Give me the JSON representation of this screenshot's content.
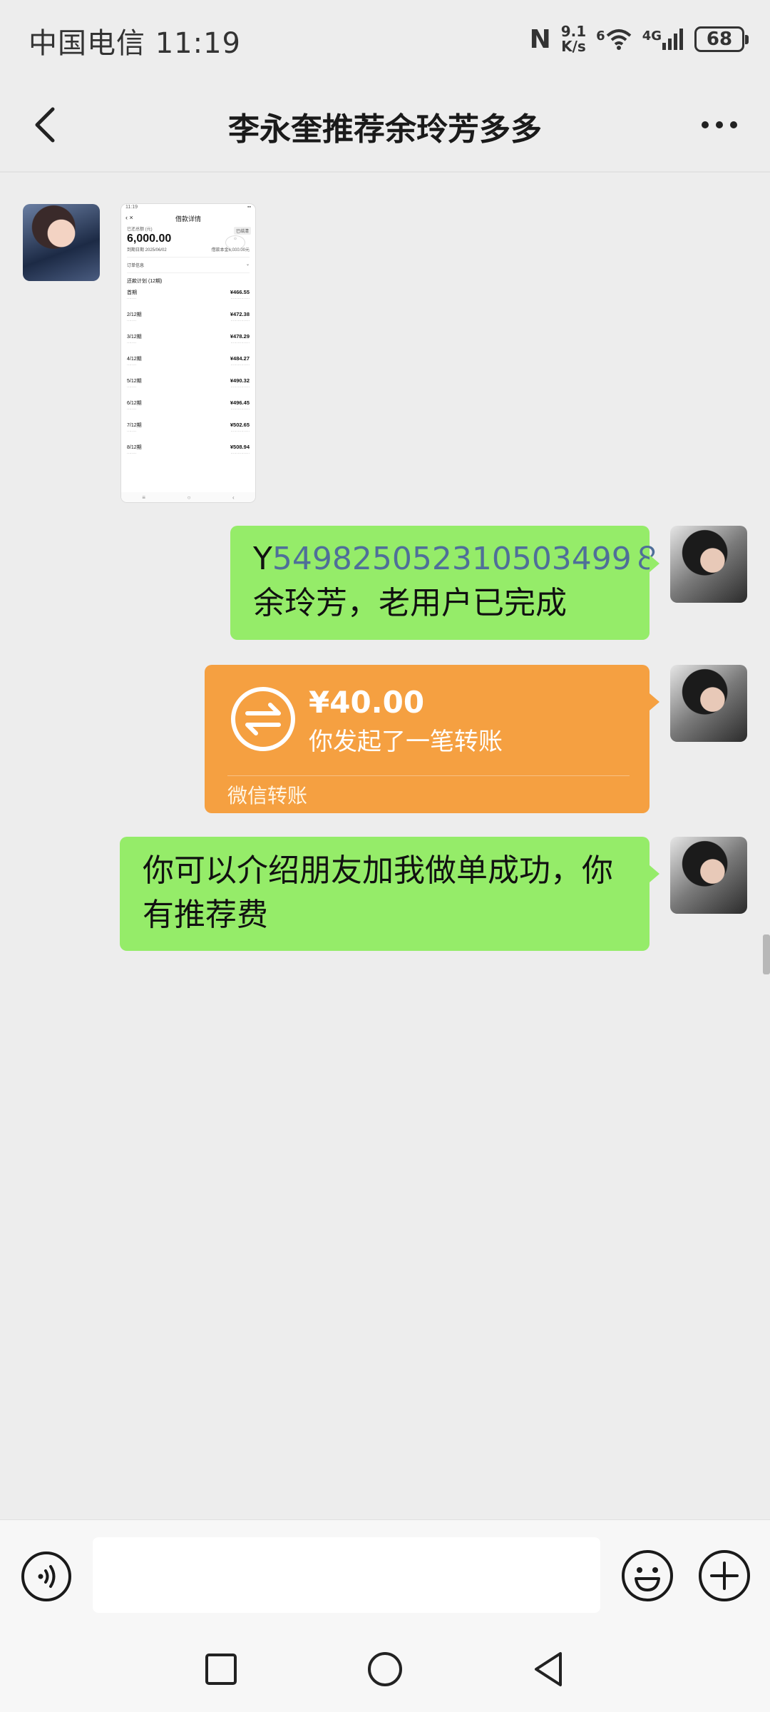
{
  "status_bar": {
    "carrier_time": "中国电信 11:19",
    "nfc": "N",
    "speed_value": "9.1",
    "speed_unit": "K/s",
    "wifi_badge": "6",
    "network": "4G",
    "battery": "68"
  },
  "header": {
    "title": "李永奎推荐余玲芳多多",
    "back_icon": "chevron-left-icon",
    "more_icon": "more-dots-icon"
  },
  "messages": {
    "image": {
      "screen_title": "借款详情",
      "status_time": "11:19",
      "amount_label": "已还总额 (元)",
      "amount": "6,000.00",
      "due_info": "到期日期 2025/06/02",
      "principal_info": "借款本金6,000.00元",
      "tag": "已结清",
      "account_label": "订单信息",
      "plan_label": "还款计划 (12期)",
      "rows": [
        {
          "period": "首期",
          "amount": "¥466.55"
        },
        {
          "period": "2/12期",
          "amount": "¥472.38"
        },
        {
          "period": "3/12期",
          "amount": "¥478.29"
        },
        {
          "period": "4/12期",
          "amount": "¥484.27"
        },
        {
          "period": "5/12期",
          "amount": "¥490.32"
        },
        {
          "period": "6/12期",
          "amount": "¥496.45"
        },
        {
          "period": "7/12期",
          "amount": "¥502.65"
        },
        {
          "period": "8/12期",
          "amount": "¥508.94"
        }
      ]
    },
    "text1": {
      "prefix": "Y",
      "link": "549825052310503499８",
      "line2": "余玲芳，老用户已完成"
    },
    "transfer": {
      "amount": "¥40.00",
      "description": "你发起了一笔转账",
      "footer": "微信转账",
      "icon": "transfer-arrows-icon"
    },
    "text2": {
      "line1": "你可以介绍朋友加我做单成功，你",
      "line2": "有推荐费"
    }
  },
  "input_bar": {
    "voice_icon": "voice-icon",
    "placeholder": "",
    "emoji_icon": "emoji-icon",
    "plus_icon": "plus-icon"
  },
  "nav_bar": {
    "recent_icon": "square-recent-icon",
    "home_icon": "circle-home-icon",
    "back_icon": "triangle-back-icon"
  }
}
